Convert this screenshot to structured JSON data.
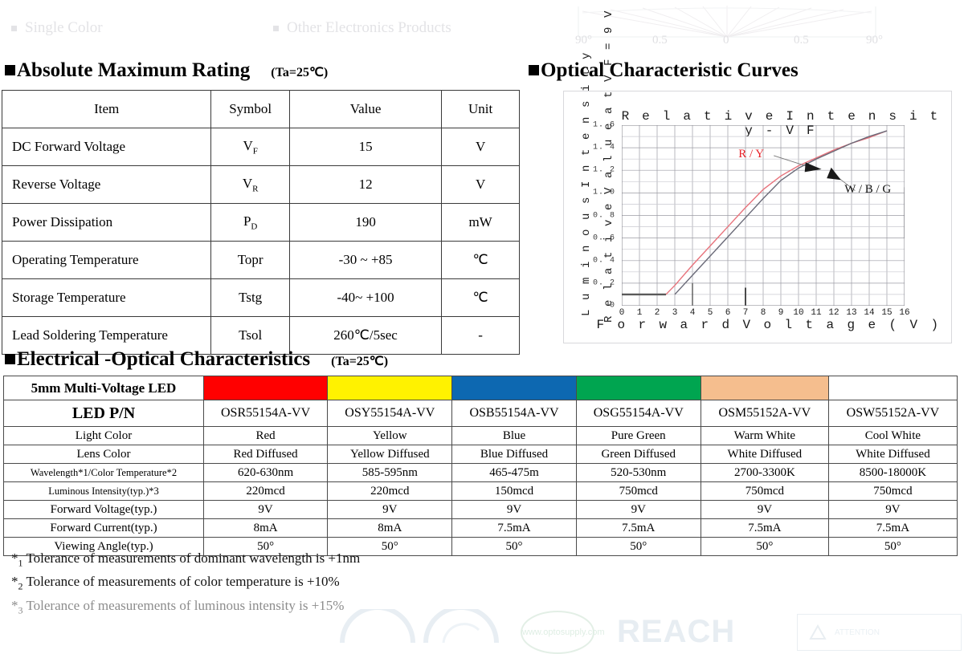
{
  "header": {
    "faded_items": [
      "Single Color",
      "Other Electronics Products"
    ],
    "polar_labels": [
      "90°",
      "0.5",
      "0",
      "0.5",
      "90°"
    ]
  },
  "sections": {
    "amr": {
      "title": "Absolute Maximum Rating",
      "note": "(Ta=25℃)"
    },
    "occ": {
      "title": "Optical Characteristic Curves"
    },
    "eoc": {
      "title": "Electrical -Optical Characteristics",
      "note": "(Ta=25℃)"
    }
  },
  "amr_table": {
    "headers": [
      "Item",
      "Symbol",
      "Value",
      "Unit"
    ],
    "rows": [
      {
        "item": "DC Forward Voltage",
        "symbol": "V",
        "sub": "F",
        "value": "15",
        "unit": "V"
      },
      {
        "item": "Reverse Voltage",
        "symbol": "V",
        "sub": "R",
        "value": "12",
        "unit": "V"
      },
      {
        "item": "Power Dissipation",
        "symbol": "P",
        "sub": "D",
        "value": "190",
        "unit": "mW"
      },
      {
        "item": "Operating Temperature",
        "symbol": "Topr",
        "sub": "",
        "value": "-30 ~ +85",
        "unit": "℃"
      },
      {
        "item": "Storage Temperature",
        "symbol": "Tstg",
        "sub": "",
        "value": "-40~ +100",
        "unit": "℃"
      },
      {
        "item": "Lead Soldering Temperature",
        "symbol": "Tsol",
        "sub": "",
        "value": "260℃/5sec",
        "unit": "-"
      }
    ]
  },
  "chart_data": {
    "type": "line",
    "title": "R e l a t i v e   I n t e n s i t y - V F",
    "title_plain": "Relative Intensity-VF",
    "xlabel": "F o r w a r d   V o l t a g e   ( V )",
    "xlabel_plain": "Forward Voltage (V)",
    "ylabel_outer": "L u m i n o u s  I n t e n s i t y",
    "ylabel_inner": "R e l a t i v e  V a l u e  a t  V F = 9 V",
    "xlim": [
      0,
      16
    ],
    "ylim": [
      0,
      1.6
    ],
    "grid": true,
    "xticks": [
      "0",
      "1",
      "2",
      "3",
      "4",
      "5",
      "6",
      "7",
      "8",
      "9",
      "10",
      "11",
      "12",
      "13",
      "14",
      "15",
      "16"
    ],
    "yticks": [
      "0",
      "0. 2",
      "0. 4",
      "0. 6",
      "0. 8",
      "1. 0",
      "1. 2",
      "1. 4",
      "1. 6"
    ],
    "annotations": [
      {
        "text": "R / Y",
        "color": "#e8232a"
      },
      {
        "text": "W / B / G",
        "color": "#111111"
      }
    ],
    "series": [
      {
        "name": "R / Y",
        "color": "#e8737c",
        "x": [
          2.5,
          3,
          4,
          5,
          6,
          7,
          8,
          9,
          10,
          11,
          12,
          13,
          14,
          15
        ],
        "y": [
          0.1,
          0.18,
          0.36,
          0.53,
          0.7,
          0.87,
          1.03,
          1.15,
          1.24,
          1.31,
          1.38,
          1.44,
          1.49,
          1.55
        ]
      },
      {
        "name": "W / B / G",
        "color": "#6a6a78",
        "x": [
          3,
          4,
          5,
          6,
          7,
          8,
          9,
          10,
          11,
          12,
          13,
          14,
          15
        ],
        "y": [
          0.1,
          0.27,
          0.44,
          0.61,
          0.78,
          0.95,
          1.11,
          1.22,
          1.3,
          1.37,
          1.44,
          1.5,
          1.55
        ]
      },
      {
        "name": "baseline",
        "color": "#5a5a5a",
        "x": [
          0,
          2.5
        ],
        "y": [
          0.1,
          0.1
        ]
      }
    ]
  },
  "eoc_table": {
    "row_labels": [
      "5mm Multi-Voltage LED",
      "LED P/N",
      "Light Color",
      "Lens Color",
      "Wavelength*1/Color Temperature*2",
      "Luminous Intensity(typ.)*3",
      "Forward Voltage(typ.)",
      "Forward Current(typ.)",
      "Viewing Angle(typ.)"
    ],
    "columns": [
      {
        "swatch": "#FF0000",
        "pn": "OSR55154A-VV",
        "light_color": "Red",
        "lens_color": "Red Diffused",
        "wavelength": "620-630nm",
        "intensity": "220mcd",
        "voltage": "9V",
        "current": "8mA",
        "angle": "50°"
      },
      {
        "swatch": "#FFF200",
        "pn": "OSY55154A-VV",
        "light_color": "Yellow",
        "lens_color": "Yellow Diffused",
        "wavelength": "585-595nm",
        "intensity": "220mcd",
        "voltage": "9V",
        "current": "8mA",
        "angle": "50°"
      },
      {
        "swatch": "#0D68B1",
        "pn": "OSB55154A-VV",
        "light_color": "Blue",
        "lens_color": "Blue Diffused",
        "wavelength": "465-475m",
        "intensity": "150mcd",
        "voltage": "9V",
        "current": "7.5mA",
        "angle": "50°"
      },
      {
        "swatch": "#00A550",
        "pn": "OSG55154A-VV",
        "light_color": "Pure Green",
        "lens_color": "Green Diffused",
        "wavelength": "520-530nm",
        "intensity": "750mcd",
        "voltage": "9V",
        "current": "7.5mA",
        "angle": "50°"
      },
      {
        "swatch": "#F5BE8E",
        "pn": "OSM55152A-VV",
        "light_color": "Warm White",
        "lens_color": "White Diffused",
        "wavelength": "2700-3300K",
        "intensity": "750mcd",
        "voltage": "9V",
        "current": "7.5mA",
        "angle": "50°"
      },
      {
        "swatch": "#FFFFFF",
        "pn": "OSW55152A-VV",
        "light_color": "Cool White",
        "lens_color": "White Diffused",
        "wavelength": "8500-18000K",
        "intensity": "750mcd",
        "voltage": "9V",
        "current": "7.5mA",
        "angle": "50°"
      }
    ]
  },
  "footnotes": [
    {
      "marker": "*1",
      "text": " Tolerance of measurements of dominant wavelength is +1nm"
    },
    {
      "marker": "*2",
      "text": " Tolerance of measurements of color temperature is +10%"
    },
    {
      "marker": "*3",
      "text": " Tolerance of measurements of luminous intensity is +15%"
    }
  ],
  "footer": {
    "reach": "REACH",
    "rohs": "www.optosupply.com",
    "attention": "ATTENTION"
  }
}
